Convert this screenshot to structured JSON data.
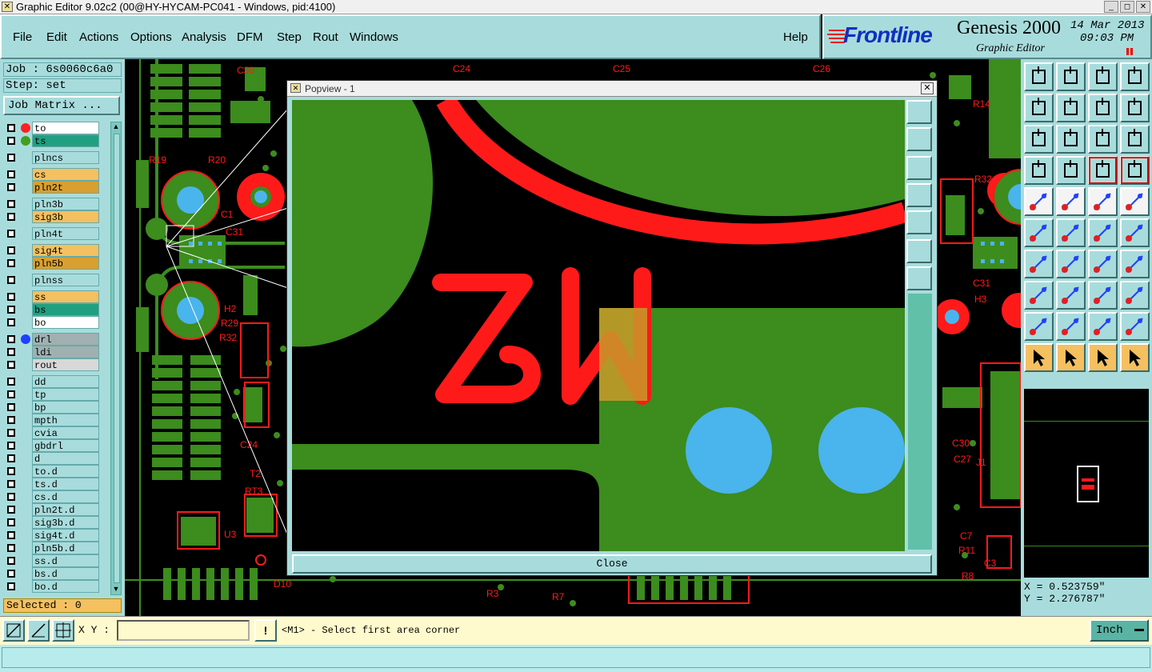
{
  "window": {
    "title": "Graphic Editor 9.02c2 (00@HY-HYCAM-PC041 - Windows, pid:4100)",
    "minimize_glyph": "_",
    "restore_glyph": "◻",
    "close_glyph": "✕"
  },
  "menu": {
    "file": "File",
    "edit": "Edit",
    "actions": "Actions",
    "options": "Options",
    "analysis": "Analysis",
    "dfm": "DFM",
    "step": "Step",
    "rout": "Rout",
    "windows": "Windows",
    "help": "Help"
  },
  "brand": {
    "logo": "Frontline",
    "product": "Genesis 2000",
    "subtitle": "Graphic Editor",
    "date": "14 Mar 2013",
    "time": "09:03 PM"
  },
  "left": {
    "job": "Job : 6s0060c6a0",
    "step": "Step: set",
    "job_matrix": "Job Matrix ...",
    "selected": "Selected : 0",
    "layers": [
      {
        "name": "to",
        "bg": "#ffffff",
        "dot": "#ff2020"
      },
      {
        "name": "ts",
        "bg": "#20a080",
        "dot": "#40a020"
      },
      {
        "name": "plncs",
        "bg": "#a8dcdc",
        "dot": ""
      },
      {
        "name": "cs",
        "bg": "#f5c060",
        "dot": ""
      },
      {
        "name": "pln2t",
        "bg": "#d8a030",
        "dot": ""
      },
      {
        "name": "pln3b",
        "bg": "#a8dcdc",
        "dot": ""
      },
      {
        "name": "sig3b",
        "bg": "#f5c060",
        "dot": ""
      },
      {
        "name": "pln4t",
        "bg": "#a8dcdc",
        "dot": ""
      },
      {
        "name": "sig4t",
        "bg": "#f5c060",
        "dot": ""
      },
      {
        "name": "pln5b",
        "bg": "#d8a030",
        "dot": ""
      },
      {
        "name": "plnss",
        "bg": "#a8dcdc",
        "dot": ""
      },
      {
        "name": "ss",
        "bg": "#f5c060",
        "dot": ""
      },
      {
        "name": "bs",
        "bg": "#20a080",
        "dot": ""
      },
      {
        "name": "bo",
        "bg": "#ffffff",
        "dot": ""
      },
      {
        "name": "drl",
        "bg": "#a0b0b0",
        "dot": "#2040ff"
      },
      {
        "name": "ldi",
        "bg": "#a0b0b0",
        "dot": ""
      },
      {
        "name": "rout",
        "bg": "#d8d8d8",
        "dot": ""
      },
      {
        "name": "dd",
        "bg": "#a8dcdc",
        "dot": ""
      },
      {
        "name": "tp",
        "bg": "#a8dcdc",
        "dot": ""
      },
      {
        "name": "bp",
        "bg": "#a8dcdc",
        "dot": ""
      },
      {
        "name": "mpth",
        "bg": "#a8dcdc",
        "dot": ""
      },
      {
        "name": "cvia",
        "bg": "#a8dcdc",
        "dot": ""
      },
      {
        "name": "gbdrl",
        "bg": "#a8dcdc",
        "dot": ""
      },
      {
        "name": "d",
        "bg": "#a8dcdc",
        "dot": ""
      },
      {
        "name": "to.d",
        "bg": "#a8dcdc",
        "dot": ""
      },
      {
        "name": "ts.d",
        "bg": "#a8dcdc",
        "dot": ""
      },
      {
        "name": "cs.d",
        "bg": "#a8dcdc",
        "dot": ""
      },
      {
        "name": "pln2t.d",
        "bg": "#a8dcdc",
        "dot": ""
      },
      {
        "name": "sig3b.d",
        "bg": "#a8dcdc",
        "dot": ""
      },
      {
        "name": "sig4t.d",
        "bg": "#a8dcdc",
        "dot": ""
      },
      {
        "name": "pln5b.d",
        "bg": "#a8dcdc",
        "dot": ""
      },
      {
        "name": "ss.d",
        "bg": "#a8dcdc",
        "dot": ""
      },
      {
        "name": "bs.d",
        "bg": "#a8dcdc",
        "dot": ""
      },
      {
        "name": "bo.d",
        "bg": "#a8dcdc",
        "dot": ""
      }
    ]
  },
  "popview": {
    "title": "Popview - 1",
    "close": "Close",
    "silk_text": "W2"
  },
  "coords": {
    "x": "X = 0.523759\"",
    "y": "Y = 2.276787\""
  },
  "command": {
    "xy_label": "X Y :",
    "xy_value": "",
    "prompt": "<M1> - Select first area corner",
    "units": "Inch"
  },
  "pcb_labels": {
    "l1": "C30",
    "l2": "C24",
    "l3": "C25",
    "l4": "C26",
    "l5": "R19",
    "l6": "R20",
    "l7": "C1",
    "l8": "C31",
    "l9": "H2",
    "l10": "R29",
    "l11": "C24",
    "l12": "R32",
    "l13": "T2",
    "l14": "RT3",
    "l15": "U3",
    "l16": "D10",
    "l17": "C30",
    "l18": "C27",
    "l19": "J1",
    "l20": "C31",
    "l21": "H3",
    "l22": "C7",
    "l23": "R11",
    "l24": "C3",
    "l25": "R8",
    "l26": "R3",
    "l27": "R7",
    "l28": "R32",
    "l29": "R14"
  },
  "colors": {
    "panel": "#a8dcdc",
    "copper": "#3c8c1e",
    "silk": "#ff1a1a",
    "drill": "#4ab4ec",
    "highlight": "#f5c060"
  }
}
